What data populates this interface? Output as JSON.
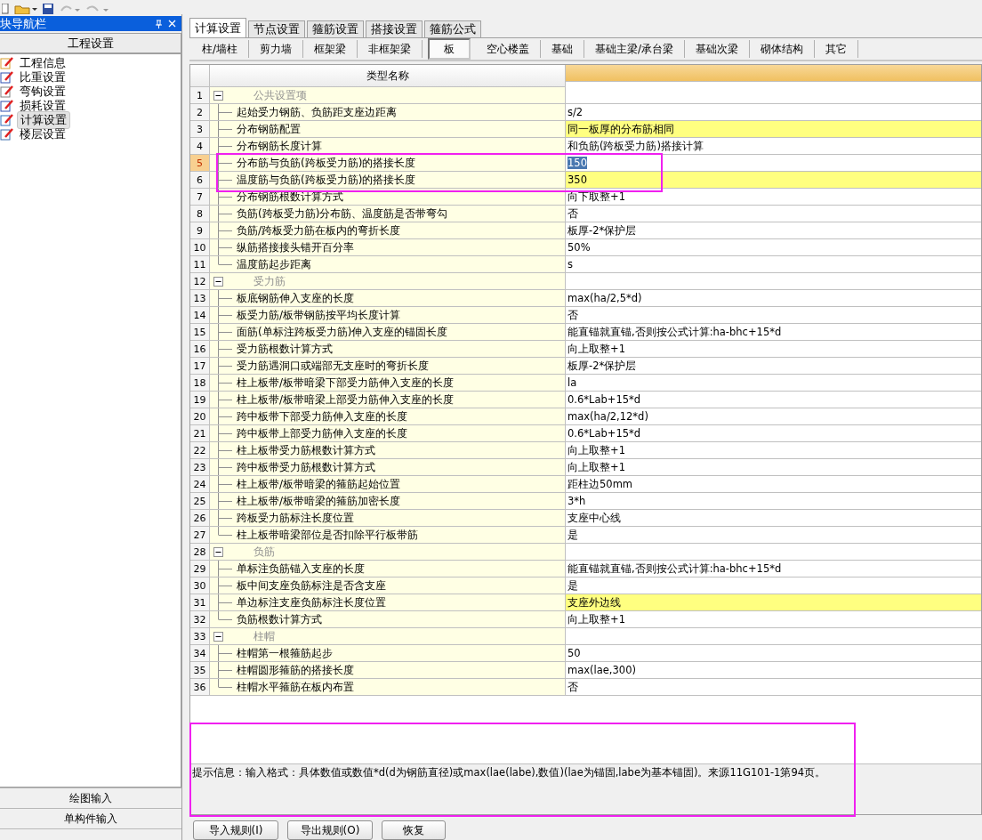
{
  "nav_panel": {
    "title": "块导航栏",
    "section": "工程设置",
    "items": [
      {
        "label": "工程信息",
        "selected": false
      },
      {
        "label": "比重设置",
        "selected": false
      },
      {
        "label": "弯钩设置",
        "selected": false
      },
      {
        "label": "损耗设置",
        "selected": false
      },
      {
        "label": "计算设置",
        "selected": true
      },
      {
        "label": "楼层设置",
        "selected": false
      }
    ],
    "bottom_buttons": [
      "绘图输入",
      "单构件输入"
    ]
  },
  "tabs": [
    {
      "label": "计算设置",
      "selected": true
    },
    {
      "label": "节点设置",
      "selected": false
    },
    {
      "label": "箍筋设置",
      "selected": false
    },
    {
      "label": "搭接设置",
      "selected": false
    },
    {
      "label": "箍筋公式",
      "selected": false
    }
  ],
  "sub_tabs": [
    {
      "label": "柱/墙柱",
      "selected": false
    },
    {
      "label": "剪力墙",
      "selected": false
    },
    {
      "label": "框架梁",
      "selected": false
    },
    {
      "label": "非框架梁",
      "selected": false
    },
    {
      "label": "板",
      "selected": true
    },
    {
      "label": "空心楼盖",
      "selected": false
    },
    {
      "label": "基础",
      "selected": false
    },
    {
      "label": "基础主梁/承台梁",
      "selected": false
    },
    {
      "label": "基础次梁",
      "selected": false
    },
    {
      "label": "砌体结构",
      "selected": false
    },
    {
      "label": "其它",
      "selected": false
    }
  ],
  "table": {
    "columns": [
      "类型名称"
    ],
    "rows": [
      {
        "number": "1",
        "kind": "group",
        "name": "公共设置项",
        "expanded": true,
        "selected": false
      },
      {
        "number": "2",
        "kind": "setting",
        "name": "起始受力钢筋、负筋距支座边距离",
        "value": "s/2",
        "highlighted": false,
        "selected": false
      },
      {
        "number": "3",
        "kind": "setting",
        "name": "分布钢筋配置",
        "value": "同一板厚的分布筋相同",
        "highlighted": true,
        "selected": false
      },
      {
        "number": "4",
        "kind": "setting",
        "name": "分布钢筋长度计算",
        "value": "和负筋(跨板受力筋)搭接计算",
        "highlighted": false,
        "selected": false
      },
      {
        "number": "5",
        "kind": "setting",
        "name": "分布筋与负筋(跨板受力筋)的搭接长度",
        "value": "150",
        "highlighted": false,
        "selected": true
      },
      {
        "number": "6",
        "kind": "setting",
        "name": "温度筋与负筋(跨板受力筋)的搭接长度",
        "value": "350",
        "highlighted": true,
        "selected": false
      },
      {
        "number": "7",
        "kind": "setting",
        "name": "分布钢筋根数计算方式",
        "value": "向下取整+1",
        "highlighted": false,
        "selected": false
      },
      {
        "number": "8",
        "kind": "setting",
        "name": "负筋(跨板受力筋)分布筋、温度筋是否带弯勾",
        "value": "否",
        "highlighted": false,
        "selected": false
      },
      {
        "number": "9",
        "kind": "setting",
        "name": "负筋/跨板受力筋在板内的弯折长度",
        "value": "板厚-2*保护层",
        "highlighted": false,
        "selected": false
      },
      {
        "number": "10",
        "kind": "setting",
        "name": "纵筋搭接接头错开百分率",
        "value": "50%",
        "highlighted": false,
        "selected": false
      },
      {
        "number": "11",
        "kind": "setting",
        "name": "温度筋起步距离",
        "value": "s",
        "highlighted": false,
        "selected": false
      },
      {
        "number": "12",
        "kind": "group",
        "name": "受力筋",
        "expanded": true,
        "selected": false
      },
      {
        "number": "13",
        "kind": "setting",
        "name": "板底钢筋伸入支座的长度",
        "value": "max(ha/2,5*d)",
        "highlighted": false,
        "selected": false
      },
      {
        "number": "14",
        "kind": "setting",
        "name": "板受力筋/板带钢筋按平均长度计算",
        "value": "否",
        "highlighted": false,
        "selected": false
      },
      {
        "number": "15",
        "kind": "setting",
        "name": "面筋(单标注跨板受力筋)伸入支座的锚固长度",
        "value": "能直锚就直锚,否则按公式计算:ha-bhc+15*d",
        "highlighted": false,
        "selected": false
      },
      {
        "number": "16",
        "kind": "setting",
        "name": "受力筋根数计算方式",
        "value": "向上取整+1",
        "highlighted": false,
        "selected": false
      },
      {
        "number": "17",
        "kind": "setting",
        "name": "受力筋遇洞口或端部无支座时的弯折长度",
        "value": "板厚-2*保护层",
        "highlighted": false,
        "selected": false
      },
      {
        "number": "18",
        "kind": "setting",
        "name": "柱上板带/板带暗梁下部受力筋伸入支座的长度",
        "value": "la",
        "highlighted": false,
        "selected": false
      },
      {
        "number": "19",
        "kind": "setting",
        "name": "柱上板带/板带暗梁上部受力筋伸入支座的长度",
        "value": "0.6*Lab+15*d",
        "highlighted": false,
        "selected": false
      },
      {
        "number": "20",
        "kind": "setting",
        "name": "跨中板带下部受力筋伸入支座的长度",
        "value": "max(ha/2,12*d)",
        "highlighted": false,
        "selected": false
      },
      {
        "number": "21",
        "kind": "setting",
        "name": "跨中板带上部受力筋伸入支座的长度",
        "value": "0.6*Lab+15*d",
        "highlighted": false,
        "selected": false
      },
      {
        "number": "22",
        "kind": "setting",
        "name": "柱上板带受力筋根数计算方式",
        "value": "向上取整+1",
        "highlighted": false,
        "selected": false
      },
      {
        "number": "23",
        "kind": "setting",
        "name": "跨中板带受力筋根数计算方式",
        "value": "向上取整+1",
        "highlighted": false,
        "selected": false
      },
      {
        "number": "24",
        "kind": "setting",
        "name": "柱上板带/板带暗梁的箍筋起始位置",
        "value": "距柱边50mm",
        "highlighted": false,
        "selected": false
      },
      {
        "number": "25",
        "kind": "setting",
        "name": "柱上板带/板带暗梁的箍筋加密长度",
        "value": "3*h",
        "highlighted": false,
        "selected": false
      },
      {
        "number": "26",
        "kind": "setting",
        "name": "跨板受力筋标注长度位置",
        "value": "支座中心线",
        "highlighted": false,
        "selected": false
      },
      {
        "number": "27",
        "kind": "setting",
        "name": "柱上板带暗梁部位是否扣除平行板带筋",
        "value": "是",
        "highlighted": false,
        "selected": false
      },
      {
        "number": "28",
        "kind": "group",
        "name": "负筋",
        "expanded": true,
        "selected": false
      },
      {
        "number": "29",
        "kind": "setting",
        "name": "单标注负筋锚入支座的长度",
        "value": "能直锚就直锚,否则按公式计算:ha-bhc+15*d",
        "highlighted": false,
        "selected": false
      },
      {
        "number": "30",
        "kind": "setting",
        "name": "板中间支座负筋标注是否含支座",
        "value": "是",
        "highlighted": false,
        "selected": false
      },
      {
        "number": "31",
        "kind": "setting",
        "name": "单边标注支座负筋标注长度位置",
        "value": "支座外边线",
        "highlighted": true,
        "selected": false
      },
      {
        "number": "32",
        "kind": "setting",
        "name": "负筋根数计算方式",
        "value": "向上取整+1",
        "highlighted": false,
        "selected": false
      },
      {
        "number": "33",
        "kind": "group",
        "name": "柱帽",
        "expanded": true,
        "selected": false
      },
      {
        "number": "34",
        "kind": "setting",
        "name": "柱帽第一根箍筋起步",
        "value": "50",
        "highlighted": false,
        "selected": false
      },
      {
        "number": "35",
        "kind": "setting",
        "name": "柱帽圆形箍筋的搭接长度",
        "value": "max(lae,300)",
        "highlighted": false,
        "selected": false
      },
      {
        "number": "36",
        "kind": "setting",
        "name": "柱帽水平箍筋在板内布置",
        "value": "否",
        "highlighted": false,
        "selected": false
      }
    ]
  },
  "hint": "提示信息：输入格式：具体数值或数值*d(d为钢筋直径)或max(lae(labe),数值)(lae为锚固,labe为基本锚固)。来源11G101-1第94页。",
  "buttons": [
    "导入规则(I)",
    "导出规则(O)",
    "恢复"
  ]
}
